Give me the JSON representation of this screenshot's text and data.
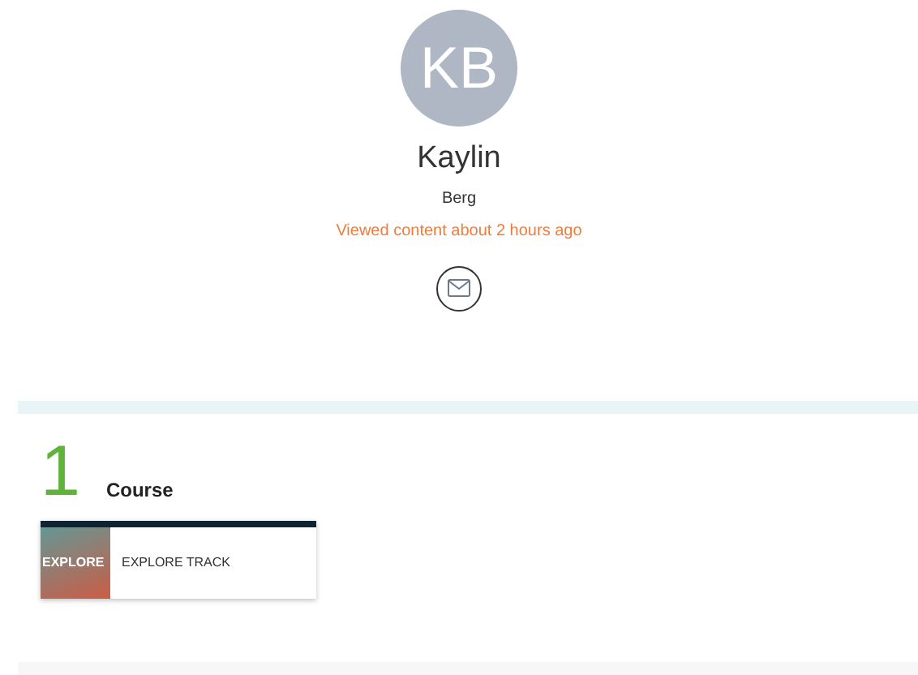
{
  "profile": {
    "initials": "KB",
    "first_name": "Kaylin",
    "last_name": "Berg",
    "activity": "Viewed content about 2 hours ago"
  },
  "courses": {
    "count": "1",
    "label": "Course",
    "items": [
      {
        "thumbnail_text": "EXPLORE",
        "title": "EXPLORE TRACK"
      }
    ]
  }
}
